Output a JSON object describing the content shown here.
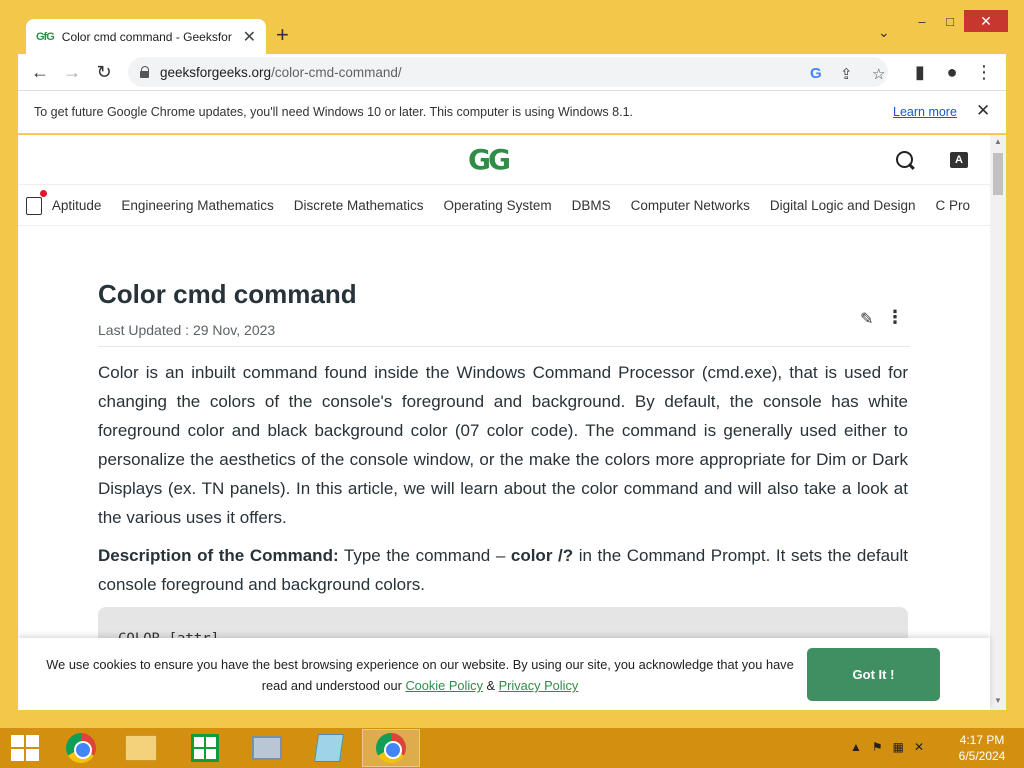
{
  "browser": {
    "tab_title": "Color cmd command - Geeksfor",
    "tab_favicon": "GfG",
    "new_tab": "+",
    "tab_menu": "⌄",
    "url_host": "geeksforgeeks.org",
    "url_path": "/color-cmd-command/",
    "win_min": "–",
    "win_max": "□",
    "win_close": "✕"
  },
  "infobar": {
    "message": "To get future Google Chrome updates, you'll need Windows 10 or later. This computer is using Windows 8.1.",
    "learn_more": "Learn more",
    "close": "✕"
  },
  "site": {
    "logo": "GG",
    "categories": [
      "Aptitude",
      "Engineering Mathematics",
      "Discrete Mathematics",
      "Operating System",
      "DBMS",
      "Computer Networks",
      "Digital Logic and Design",
      "C Pro"
    ]
  },
  "article": {
    "title": "Color cmd command",
    "last_updated": "Last Updated : 29 Nov, 2023",
    "para1": "Color is an inbuilt command found inside the Windows Command Processor (cmd.exe), that is used for changing the colors of the console's foreground and background. By default, the console has white foreground color and black background color (07 color code). The command is generally used either to personalize the aesthetics of the console window, or the make the colors more appropriate for Dim or Dark Displays (ex. TN panels). In this article, we will learn about the color command and will also take a look at the various uses it offers.",
    "p2_label": "Description of the Command:",
    "p2_text1": " Type the command – ",
    "p2_cmd": "color /?",
    "p2_text2": " in the Command Prompt. It sets the default console foreground and background colors.",
    "code": "COLOR [attr]"
  },
  "cookie": {
    "text_before": "We use cookies to ensure you have the best browsing experience on our website. By using our site, you acknowledge that you have read and understood our ",
    "cookie_policy": "Cookie Policy",
    "amp": " & ",
    "privacy_policy": "Privacy Policy",
    "button": "Got It !"
  },
  "taskbar": {
    "time": "4:17 PM",
    "date": "6/5/2024"
  },
  "colors": {
    "accent": "#2f8d46",
    "taskbar": "#d39010",
    "frame": "#f3c84a"
  }
}
